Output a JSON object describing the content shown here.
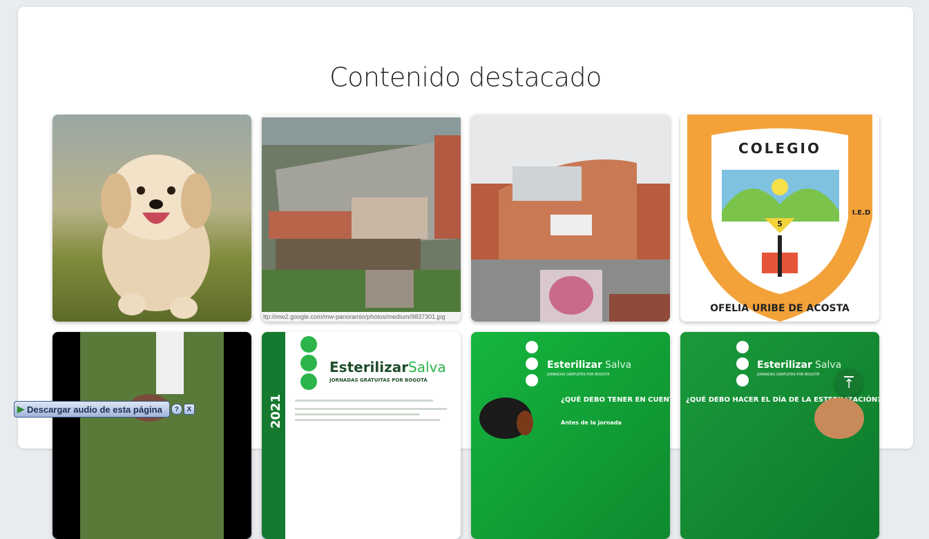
{
  "section": {
    "title": "Contenido destacado"
  },
  "cards": [
    {
      "name": "puppy"
    },
    {
      "name": "school-courtyard",
      "caption": "ttp://mw2.google.com/mw-panoramio/photos/medium/9837301.jpg"
    },
    {
      "name": "school-building"
    },
    {
      "name": "school-crest",
      "top_text": "COLEGIO",
      "arc_text": "OFELIA URIBE DE ACOSTA",
      "side_text": "I.E.D",
      "number": "5"
    },
    {
      "name": "pet-food"
    },
    {
      "name": "esterilizar-doc",
      "brand_bold": "Esterilizar",
      "brand_light": "Salva",
      "subtitle": "JORNADAS GRATUITAS POR BOGOTÁ",
      "year": "2021"
    },
    {
      "name": "esterilizar-green-1",
      "brand_bold": "Esterilizar",
      "brand_light": "Salva",
      "subtitle": "JORNADAS GRATUITAS POR BOGOTÁ",
      "question": "¿QUÉ DEBO TENER EN CUENTA PARA EL PROCEDIMIENTO?",
      "note": "Antes de la jornada"
    },
    {
      "name": "esterilizar-green-2",
      "brand_bold": "Esterilizar",
      "brand_light": "Salva",
      "subtitle": "JORNADAS GRATUITAS POR BOGOTÁ",
      "question": "¿QUÉ DEBO HACER EL DÍA DE LA ESTERILIZACIÓN?"
    }
  ],
  "audio": {
    "label": "Descargar audio de esta página",
    "help": "?",
    "close": "X"
  },
  "colors": {
    "green": "#157a2f",
    "accent_green": "#2bb54a"
  }
}
